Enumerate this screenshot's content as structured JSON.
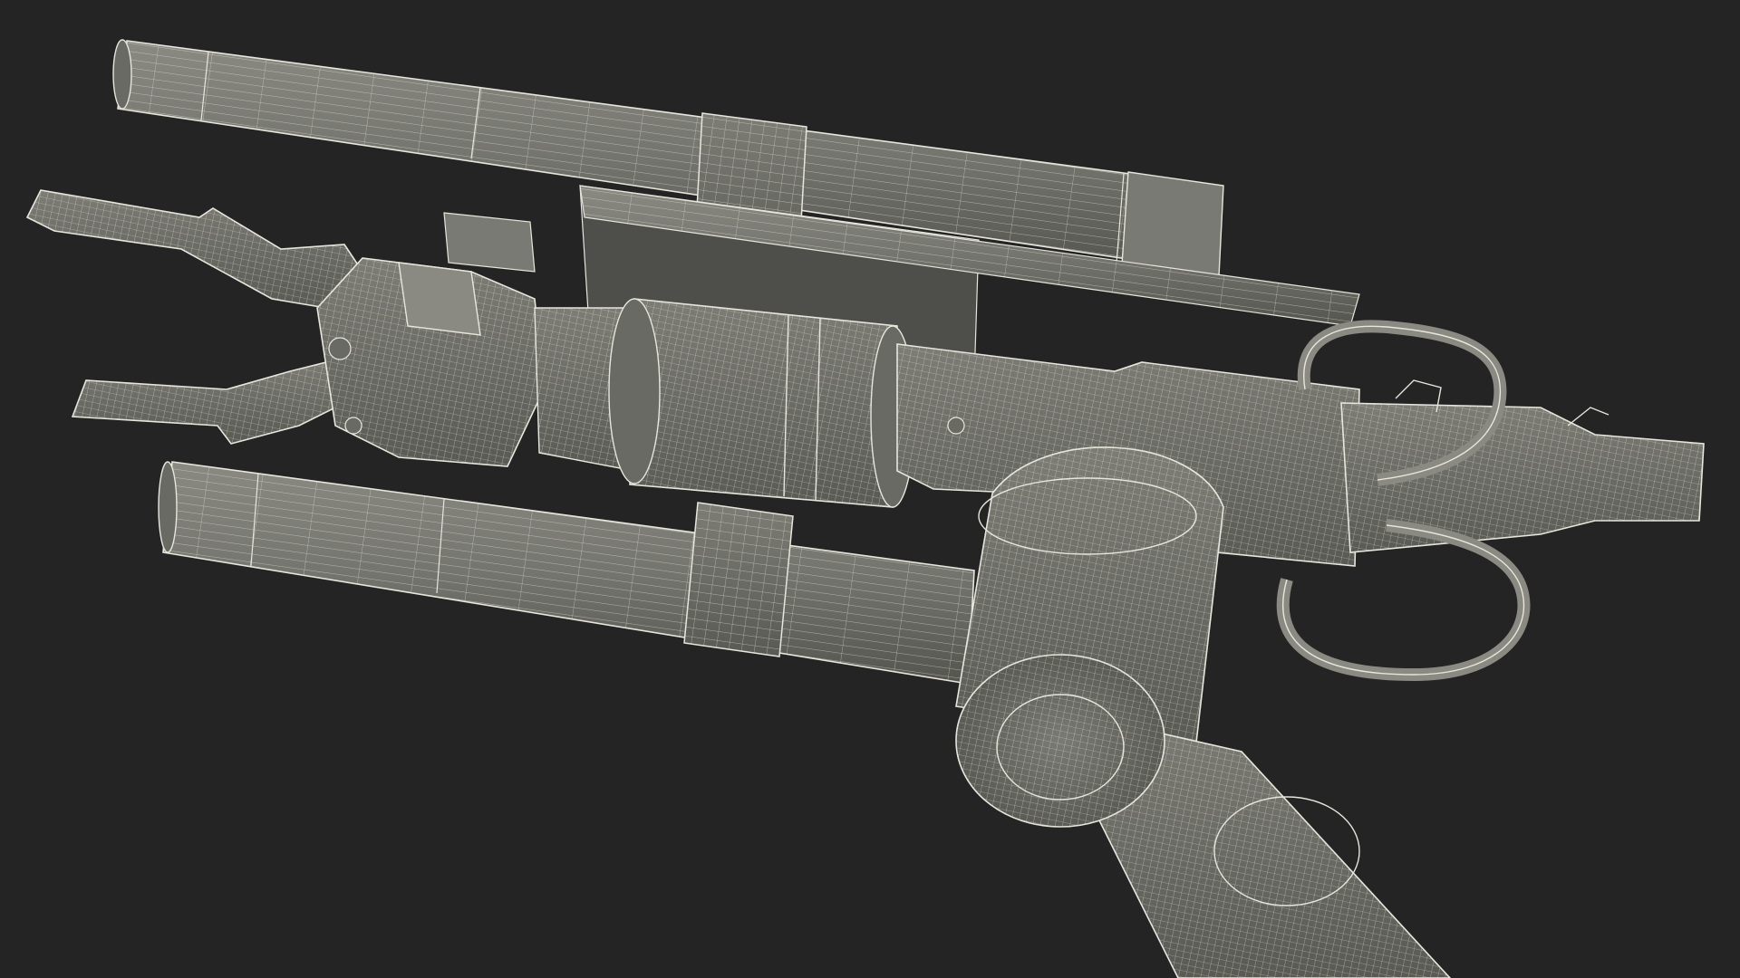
{
  "scene": {
    "subject": "robotic-arm-gripper-wireframe",
    "render_style": "wireframe",
    "colors": {
      "background": "#242424",
      "surface": "#6e6e68",
      "surface_light": "#8a8a83",
      "surface_dark": "#4c4c48",
      "wire": "#e6e6dc"
    },
    "parts": [
      "upper-cylinder",
      "lower-cylinder",
      "gripper-finger-upper",
      "gripper-finger-lower",
      "wrist-block",
      "rotary-joint",
      "horizontal-boom",
      "front-muzzle",
      "cable-loop-upper",
      "cable-loop-lower",
      "elbow-motor-housing",
      "lower-arm-link"
    ]
  }
}
